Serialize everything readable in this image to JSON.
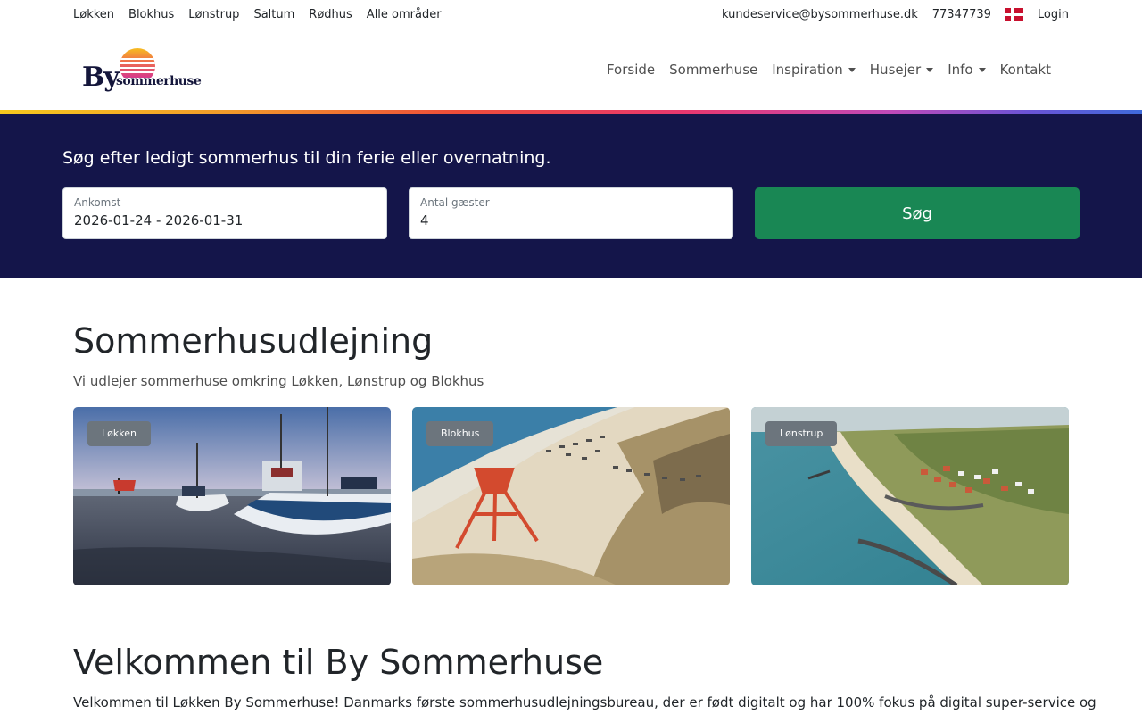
{
  "topbar": {
    "areas": [
      "Løkken",
      "Blokhus",
      "Lønstrup",
      "Saltum",
      "Rødhus",
      "Alle områder"
    ],
    "email": "kundeservice@bysommerhuse.dk",
    "phone": "77347739",
    "language_flag": "flag-denmark-icon",
    "login": "Login"
  },
  "header": {
    "logo": {
      "by": "By",
      "sommerhuse": "sommerhuse"
    },
    "nav": [
      {
        "label": "Forside",
        "dropdown": false
      },
      {
        "label": "Sommerhuse",
        "dropdown": false
      },
      {
        "label": "Inspiration",
        "dropdown": true
      },
      {
        "label": "Husejer",
        "dropdown": true
      },
      {
        "label": "Info",
        "dropdown": true
      },
      {
        "label": "Kontakt",
        "dropdown": false
      }
    ]
  },
  "search": {
    "heading": "Søg efter ledigt sommerhus til din ferie eller overnatning.",
    "arrival_label": "Ankomst",
    "arrival_value": "2026-01-24 - 2026-01-31",
    "guests_label": "Antal gæster",
    "guests_value": "4",
    "button": "Søg"
  },
  "main": {
    "title": "Sommerhusudlejning",
    "subtitle": "Vi udlejer sommerhuse omkring Løkken, Lønstrup og Blokhus",
    "cards": [
      {
        "badge": "Løkken"
      },
      {
        "badge": "Blokhus"
      },
      {
        "badge": "Lønstrup"
      }
    ],
    "welcome_title": "Velkommen til By Sommerhuse",
    "welcome_text": "Velkommen til Løkken By Sommerhuse! Danmarks første sommerhusudlejningsbureau, der er født digitalt og har 100% fokus på digital super-service og"
  },
  "colors": {
    "band": "#14154a",
    "search_button": "#198754",
    "badge": "#6c757d"
  }
}
